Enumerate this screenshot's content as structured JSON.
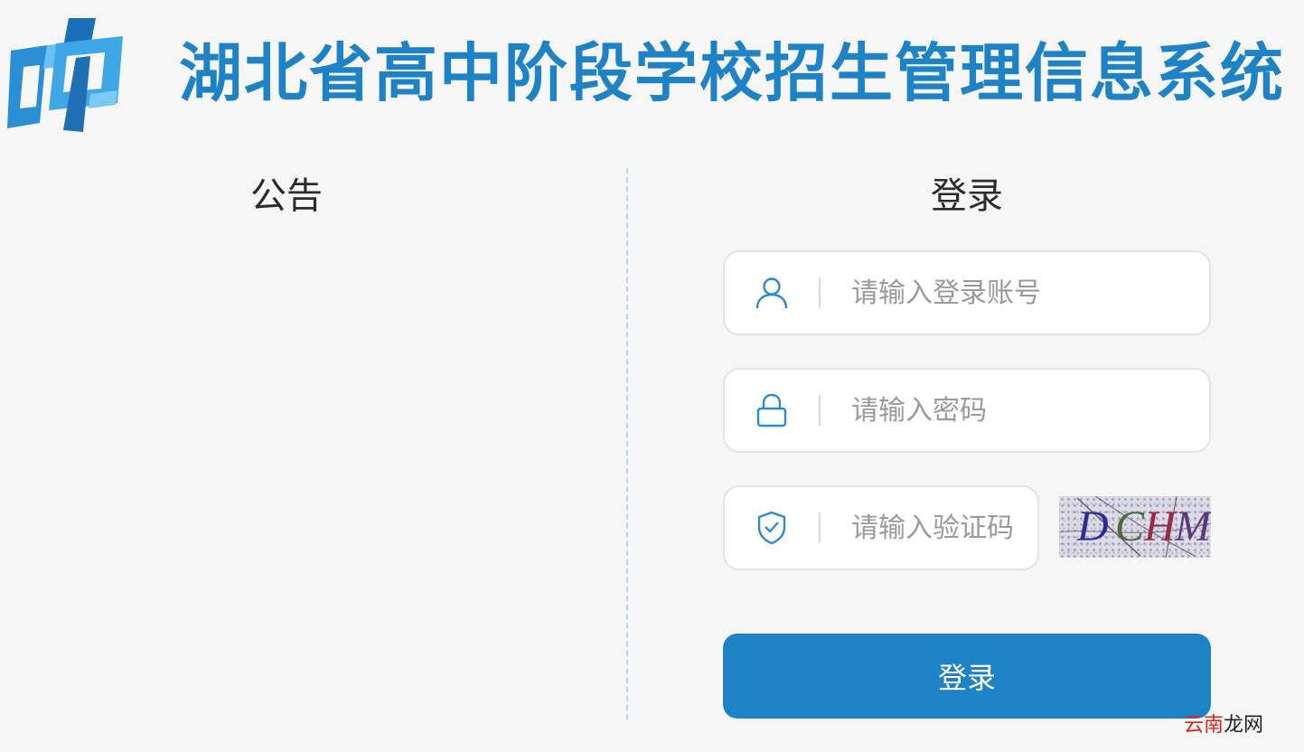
{
  "header": {
    "title": "湖北省高中阶段学校招生管理信息系统",
    "logo_icon": "blue-cp-logo-icon",
    "brand_color": "#1e82c7"
  },
  "notice": {
    "title": "公告"
  },
  "login": {
    "title": "登录",
    "username": {
      "placeholder": "请输入登录账号",
      "value": "",
      "icon": "user-icon"
    },
    "password": {
      "placeholder": "请输入密码",
      "value": "",
      "icon": "lock-icon"
    },
    "captcha": {
      "placeholder": "请输入验证码",
      "value": "",
      "icon": "shield-check-icon",
      "image_text": "DCHM"
    },
    "submit_label": "登录"
  },
  "watermark": {
    "part1": "云南",
    "part2": "龙网"
  }
}
